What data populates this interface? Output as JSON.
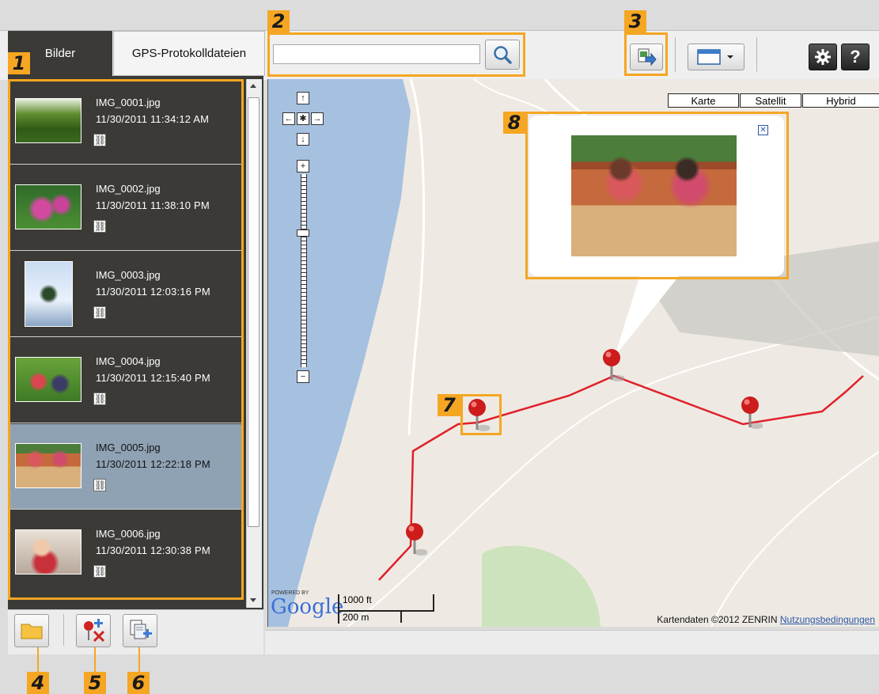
{
  "tabs": {
    "images": "Bilder",
    "gps_logs": "GPS-Protokolldateien"
  },
  "search": {
    "value": "",
    "placeholder": ""
  },
  "images": [
    {
      "name": "IMG_0001.jpg",
      "date": "11/30/2011 11:34:12 AM"
    },
    {
      "name": "IMG_0002.jpg",
      "date": "11/30/2011 11:38:10 PM"
    },
    {
      "name": "IMG_0003.jpg",
      "date": "11/30/2011 12:03:16 PM"
    },
    {
      "name": "IMG_0004.jpg",
      "date": "11/30/2011 12:15:40 PM"
    },
    {
      "name": "IMG_0005.jpg",
      "date": "11/30/2011 12:22:18 PM"
    },
    {
      "name": "IMG_0006.jpg",
      "date": "11/30/2011 12:30:38 PM"
    }
  ],
  "selected_image": "IMG_0005.jpg",
  "map": {
    "types": [
      "Karte",
      "Satellit",
      "Hybrid"
    ],
    "powered_by": "POWERED BY",
    "brand": "Google",
    "scale_ft": "1000 ft",
    "scale_m": "200 m",
    "copyright": "Kartendaten ©2012 ZENRIN",
    "terms_link": "Nutzungsbedingungen"
  },
  "callouts": [
    "1",
    "2",
    "3",
    "4",
    "5",
    "6",
    "7",
    "8"
  ],
  "icons": [
    "search-icon",
    "export-icon",
    "window-icon",
    "chevron-down-icon",
    "gear-icon",
    "help-icon",
    "folder-icon",
    "remove-pin-icon",
    "add-copy-icon",
    "gps-link-icon",
    "close-icon",
    "map-pin-icon"
  ],
  "colors": {
    "accent": "#f5a623",
    "panel": "#3b3a36",
    "selected": "#8fa2b4",
    "track": "#e0202a",
    "water": "#a6c0e0"
  }
}
